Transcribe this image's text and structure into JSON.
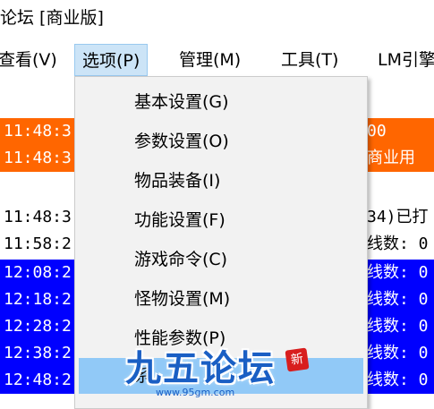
{
  "window": {
    "title": "论坛 [商业版]"
  },
  "menubar": {
    "items": [
      "查看(V)",
      "选项(P)",
      "管理(M)",
      "工具(T)",
      "LM引擎"
    ]
  },
  "log": {
    "rows": [
      {
        "time": "11:48:3",
        "right": "00",
        "style": "orange"
      },
      {
        "time": "11:48:3",
        "right": "商业用",
        "style": "orange"
      },
      {
        "time": "",
        "right": "",
        "style": "white"
      },
      {
        "time": "11:48:3",
        "right": "34)已打",
        "style": "white"
      },
      {
        "time": "11:58:2",
        "right": "线数: 0",
        "style": "white"
      },
      {
        "time": "12:08:2",
        "right": "线数: 0",
        "style": "blue"
      },
      {
        "time": "12:18:2",
        "right": "线数: 0",
        "style": "blue"
      },
      {
        "time": "12:28:2",
        "right": "线数: 0",
        "style": "blue"
      },
      {
        "time": "12:38:2",
        "right": "线数: 0",
        "style": "blue"
      },
      {
        "time": "12:48:2",
        "right": "线数: 0",
        "style": "blue"
      }
    ]
  },
  "dropdown": {
    "items": [
      "基本设置(G)",
      "参数设置(O)",
      "物品装备(I)",
      "功能设置(F)",
      "游戏命令(C)",
      "怪物设置(M)",
      "性能参数(P)",
      "系"
    ]
  },
  "watermark": {
    "text": "九五论坛",
    "url": "www.95gm.com",
    "seal": "新"
  },
  "colors": {
    "orange": "#ff6600",
    "blue": "#0000ff",
    "highlight": "#91c9f7",
    "menu_active": "#cce4f7"
  }
}
